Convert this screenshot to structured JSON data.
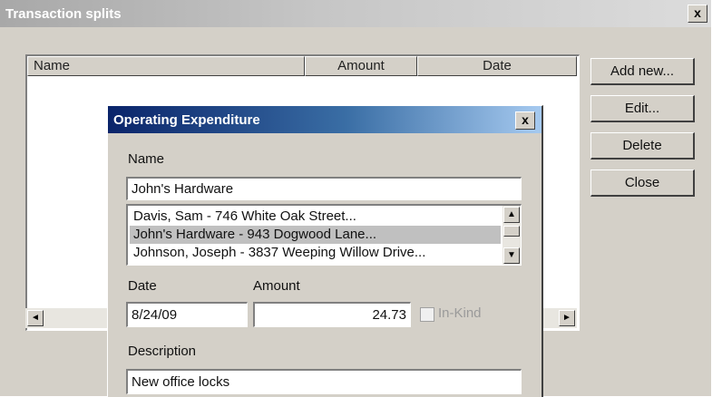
{
  "main_window": {
    "title": "Transaction splits",
    "close_label": "x",
    "columns": [
      "Name",
      "Amount",
      "Date"
    ],
    "buttons": [
      "Add new...",
      "Edit...",
      "Delete",
      "Close"
    ],
    "scroll_left": "◄",
    "scroll_right": "►"
  },
  "dialog": {
    "title": "Operating Expenditure",
    "close_label": "x",
    "name_label": "Name",
    "name_value": "John's Hardware",
    "vendor_list": [
      "Davis, Sam - 746 White Oak Street...",
      "John's Hardware - 943 Dogwood Lane...",
      "Johnson, Joseph - 3837 Weeping Willow Drive..."
    ],
    "selected_index": 1,
    "scroll_up": "▲",
    "scroll_down": "▼",
    "date_label": "Date",
    "date_value": "8/24/09",
    "amount_label": "Amount",
    "amount_value": "24.73",
    "inkind_label": "In-Kind",
    "inkind_checked": false,
    "description_label": "Description",
    "description_value": "New office locks"
  },
  "colors": {
    "window_bg": "#d4d0c8",
    "active_title": "#0a246a",
    "inactive_title": "#a8a8a8"
  }
}
